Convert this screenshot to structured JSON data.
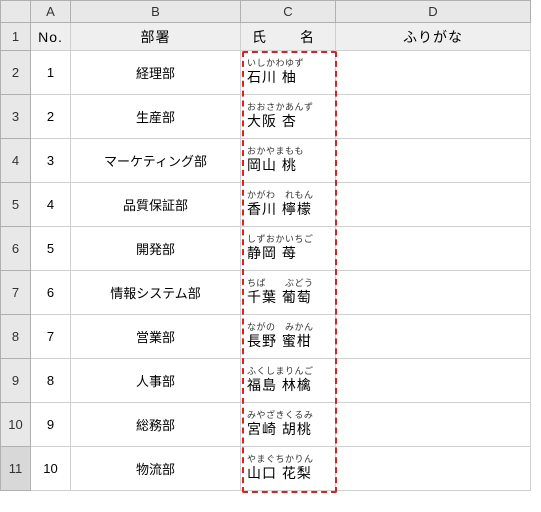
{
  "columns": {
    "corner": "",
    "A": "A",
    "B": "B",
    "C": "C",
    "D": "D"
  },
  "rowHeaders": [
    "1",
    "2",
    "3",
    "4",
    "5",
    "6",
    "7",
    "8",
    "9",
    "10",
    "11"
  ],
  "header": {
    "no": "No.",
    "dept": "部署",
    "name": "氏　名",
    "furigana": "ふりがな"
  },
  "rows": [
    {
      "no": "1",
      "dept": "経理部",
      "ruby": "いしかわゆず",
      "name": "石川 柚"
    },
    {
      "no": "2",
      "dept": "生産部",
      "ruby": "おおさかあんず",
      "name": "大阪 杏"
    },
    {
      "no": "3",
      "dept": "マーケティング部",
      "ruby": "おかやまもも",
      "name": "岡山 桃"
    },
    {
      "no": "4",
      "dept": "品質保証部",
      "ruby": "かがわ　れもん",
      "name": "香川 檸檬"
    },
    {
      "no": "5",
      "dept": "開発部",
      "ruby": "しずおかいちご",
      "name": "静岡 苺"
    },
    {
      "no": "6",
      "dept": "情報システム部",
      "ruby": "ちば　　ぶどう",
      "name": "千葉 葡萄"
    },
    {
      "no": "7",
      "dept": "営業部",
      "ruby": "ながの　みかん",
      "name": "長野 蜜柑"
    },
    {
      "no": "8",
      "dept": "人事部",
      "ruby": "ふくしまりんご",
      "name": "福島 林檎"
    },
    {
      "no": "9",
      "dept": "総務部",
      "ruby": "みやざきくるみ",
      "name": "宮崎 胡桃"
    },
    {
      "no": "10",
      "dept": "物流部",
      "ruby": "やまぐちかりん",
      "name": "山口 花梨"
    }
  ],
  "chart_data": {
    "type": "table",
    "title": "",
    "columns": [
      "No.",
      "部署",
      "氏名",
      "ふりがな"
    ],
    "rows": [
      [
        1,
        "経理部",
        "石川 柚",
        "いしかわゆず"
      ],
      [
        2,
        "生産部",
        "大阪 杏",
        "おおさかあんず"
      ],
      [
        3,
        "マーケティング部",
        "岡山 桃",
        "おかやまもも"
      ],
      [
        4,
        "品質保証部",
        "香川 檸檬",
        "かがわれもん"
      ],
      [
        5,
        "開発部",
        "静岡 苺",
        "しずおかいちご"
      ],
      [
        6,
        "情報システム部",
        "千葉 葡萄",
        "ちばぶどう"
      ],
      [
        7,
        "営業部",
        "長野 蜜柑",
        "ながのみかん"
      ],
      [
        8,
        "人事部",
        "福島 林檎",
        "ふくしまりんご"
      ],
      [
        9,
        "総務部",
        "宮崎 胡桃",
        "みやざきくるみ"
      ],
      [
        10,
        "物流部",
        "山口 花梨",
        "やまぐちかりん"
      ]
    ]
  },
  "selection": {
    "col": "C",
    "startRow": 2,
    "endRow": 11
  }
}
